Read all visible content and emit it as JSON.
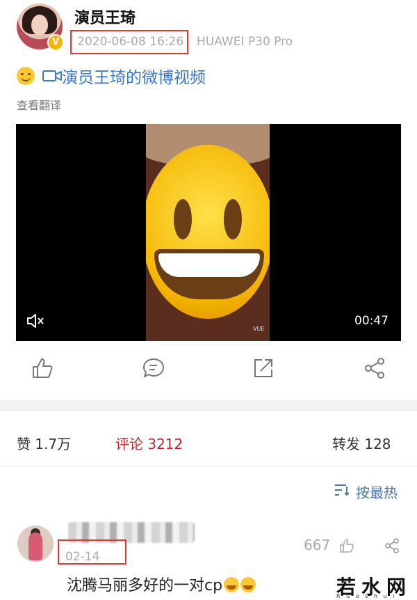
{
  "post": {
    "username": "演员王琦",
    "timestamp": "2020-06-08 16:26",
    "device": "HUAWEI P30 Pro",
    "text_link": "演员王琦的微博视频",
    "translate": "查看翻译"
  },
  "video": {
    "duration": "00:47",
    "overlay_text": "VUE"
  },
  "actions": {
    "icons": [
      "thumbs-up-icon",
      "comment-icon",
      "share-icon",
      "forward-icon"
    ]
  },
  "stats": {
    "likes": "赞  1.7万",
    "comments": "评论  3212",
    "reposts": "转发  128"
  },
  "sort": {
    "label": "按最热"
  },
  "comment": {
    "date": "02-14",
    "likes": "667",
    "text": "沈腾马丽多好的一对cp"
  },
  "watermark": {
    "text": "若水网",
    "sub": "R u o s h u i"
  },
  "colors": {
    "link_blue": "#3a77c4",
    "accent_red": "#c2252b",
    "highlight_box": "#e53935"
  }
}
